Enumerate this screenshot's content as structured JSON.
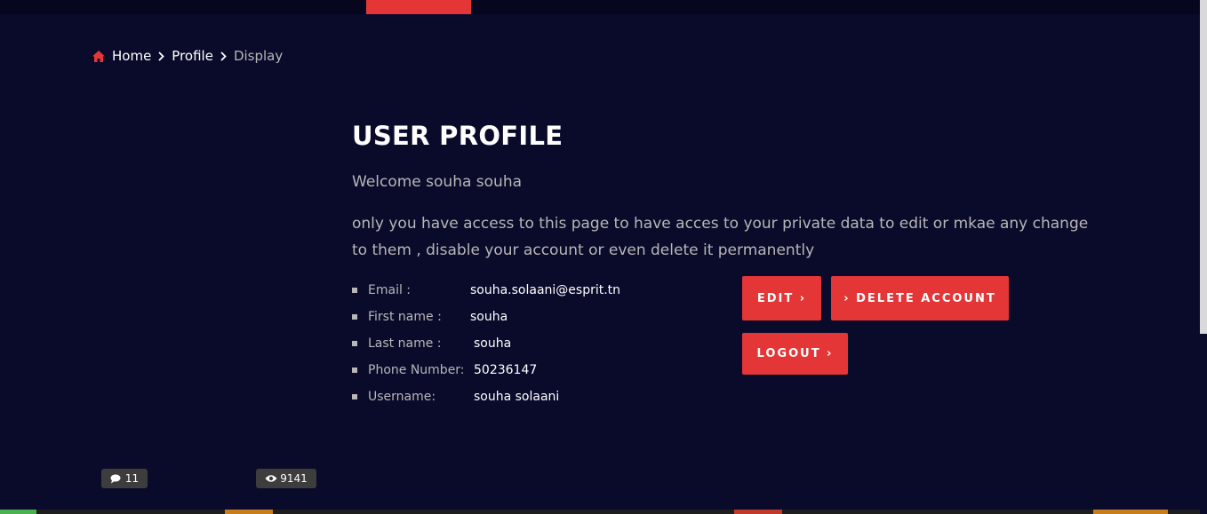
{
  "breadcrumb": {
    "home": "Home",
    "profile": "Profile",
    "current": "Display"
  },
  "profile": {
    "title": "USER PROFILE",
    "welcome": "Welcome souha souha",
    "description": "only you have access to this page to have acces to your private data to edit or mkae any change to them , disable your account or even delete it permanently",
    "fields": [
      {
        "label": "Email :",
        "value": "souha.solaani@esprit.tn"
      },
      {
        "label": "First name :",
        "value": "souha"
      },
      {
        "label": "Last name :",
        "value": "souha"
      },
      {
        "label": "Phone Number:",
        "value": "50236147"
      },
      {
        "label": "Username:",
        "value": "souha solaani"
      }
    ]
  },
  "actions": {
    "edit": "EDIT ›",
    "delete": "› DELETE ACCOUNT",
    "logout": "LOGOUT ›"
  },
  "stats": {
    "comments": "11",
    "views": "9141"
  },
  "icons": {
    "home": "home-icon",
    "chevron": "chevron-right-icon",
    "comments": "comments-icon",
    "eye": "eye-icon"
  },
  "colors": {
    "background": "#0a0b2b",
    "accent": "#e53637",
    "muted_text": "#b7b7b7",
    "badge": "#3d3d3d"
  }
}
